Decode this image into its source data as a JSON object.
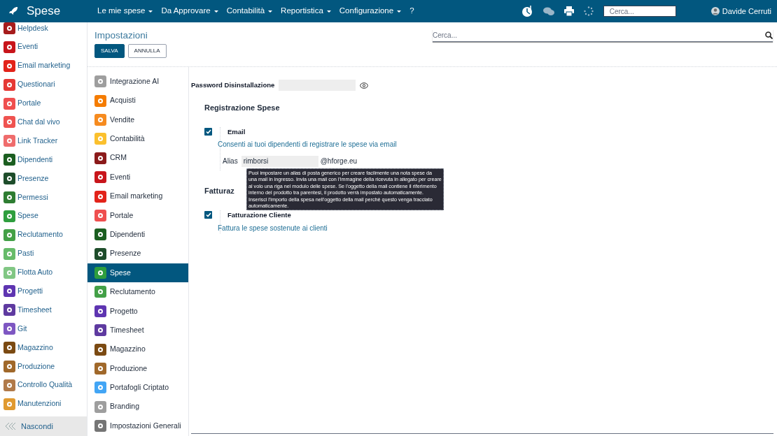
{
  "app": {
    "title": "Spese"
  },
  "nav": [
    {
      "label": "Le mie spese",
      "dropdown": true
    },
    {
      "label": "Da Approvare",
      "dropdown": true
    },
    {
      "label": "Contabilità",
      "dropdown": true
    },
    {
      "label": "Reportistica",
      "dropdown": true
    },
    {
      "label": "Configurazione",
      "dropdown": true
    },
    {
      "label": "?",
      "dropdown": false
    }
  ],
  "header_search": {
    "placeholder": "Cerca..."
  },
  "user": {
    "name": "Davide Cerruti"
  },
  "sidebar": {
    "items": [
      {
        "label": "Helpdesk",
        "color": "#a61c1c"
      },
      {
        "label": "Eventi",
        "color": "#c8151b"
      },
      {
        "label": "Email marketing",
        "color": "#e2231a"
      },
      {
        "label": "Questionari",
        "color": "#e53935"
      },
      {
        "label": "Portale",
        "color": "#ef4f4f"
      },
      {
        "label": "Chat dal vivo",
        "color": "#ef5350"
      },
      {
        "label": "Link Tracker",
        "color": "#ef6c6c"
      },
      {
        "label": "Dipendenti",
        "color": "#1b5e20"
      },
      {
        "label": "Presenze",
        "color": "#1e4d2b"
      },
      {
        "label": "Permessi",
        "color": "#2e7d32"
      },
      {
        "label": "Spese",
        "color": "#2e9e3e"
      },
      {
        "label": "Reclutamento",
        "color": "#43a047"
      },
      {
        "label": "Pasti",
        "color": "#66bb6a"
      },
      {
        "label": "Flotta Auto",
        "color": "#81c784"
      },
      {
        "label": "Progetti",
        "color": "#5e35b1"
      },
      {
        "label": "Timesheet",
        "color": "#5e3aa0"
      },
      {
        "label": "Git",
        "color": "#7e57c2"
      },
      {
        "label": "Magazzino",
        "color": "#7b4a12"
      },
      {
        "label": "Produzione",
        "color": "#a0682a"
      },
      {
        "label": "Controllo Qualità",
        "color": "#b07a4a"
      },
      {
        "label": "Manutenzioni",
        "color": "#e09a30"
      }
    ],
    "hide_label": "Nascondi"
  },
  "page": {
    "title": "Impostazioni",
    "search": {
      "placeholder": "Cerca..."
    },
    "buttons": [
      {
        "label": "SALVA",
        "kind": "primary"
      },
      {
        "label": "ANNULLA",
        "kind": "secondary"
      }
    ]
  },
  "settings_menu": [
    {
      "label": "Integrazione AI",
      "color": "#9e9e9e",
      "selected": false
    },
    {
      "label": "Acquisti",
      "color": "#f57c00",
      "selected": false
    },
    {
      "label": "Vendite",
      "color": "#f68b1f",
      "selected": false
    },
    {
      "label": "Contabilità",
      "color": "#fbc02d",
      "selected": false
    },
    {
      "label": "CRM",
      "color": "#8b1a1a",
      "selected": false
    },
    {
      "label": "Eventi",
      "color": "#c8151b",
      "selected": false
    },
    {
      "label": "Email marketing",
      "color": "#e2231a",
      "selected": false
    },
    {
      "label": "Portale",
      "color": "#ef4f4f",
      "selected": false
    },
    {
      "label": "Dipendenti",
      "color": "#1b5e20",
      "selected": false
    },
    {
      "label": "Presenze",
      "color": "#1e4d2b",
      "selected": false
    },
    {
      "label": "Spese",
      "color": "#2e9e3e",
      "selected": true
    },
    {
      "label": "Reclutamento",
      "color": "#43a047",
      "selected": false
    },
    {
      "label": "Progetto",
      "color": "#5e35b1",
      "selected": false
    },
    {
      "label": "Timesheet",
      "color": "#5e3aa0",
      "selected": false
    },
    {
      "label": "Magazzino",
      "color": "#7b4a12",
      "selected": false
    },
    {
      "label": "Produzione",
      "color": "#a0682a",
      "selected": false
    },
    {
      "label": "Portafogli Criptato",
      "color": "#42a5f5",
      "selected": false
    },
    {
      "label": "Branding",
      "color": "#9e9e9e",
      "selected": false
    },
    {
      "label": "Impostazioni Generali",
      "color": "#757575",
      "selected": false
    }
  ],
  "settings": {
    "password_label": "Password Disinstallazione",
    "sections": [
      {
        "title": "Registrazione Spese",
        "options": [
          {
            "label": "Email",
            "description": "Consenti ai tuoi dipendenti di registrare le spese via email",
            "checked": true,
            "alias": {
              "label": "Alias",
              "value": "rimborsi",
              "suffix": "@hforge.eu"
            }
          }
        ]
      },
      {
        "title": "Fatturaz",
        "options": [
          {
            "label": "Fatturazione Cliente",
            "description": "Fattura le spese sostenute ai clienti",
            "checked": true
          }
        ]
      }
    ]
  },
  "tooltip": "Puoi impostare un alias di posta generico per creare facilmente una nota spese da una mail in ingresso. Invia una mail con l'immagine della ricevuta in allegato per creare al volo una riga nel modulo delle spese. Se l'oggetto della mail contiene il riferimento interno del prodotto tra parentesi, il prodotto verrà impostato automaticamente. Inserisci l'importo della spesa nell'oggetto della mail perchè questo venga tracciato automaticamente."
}
